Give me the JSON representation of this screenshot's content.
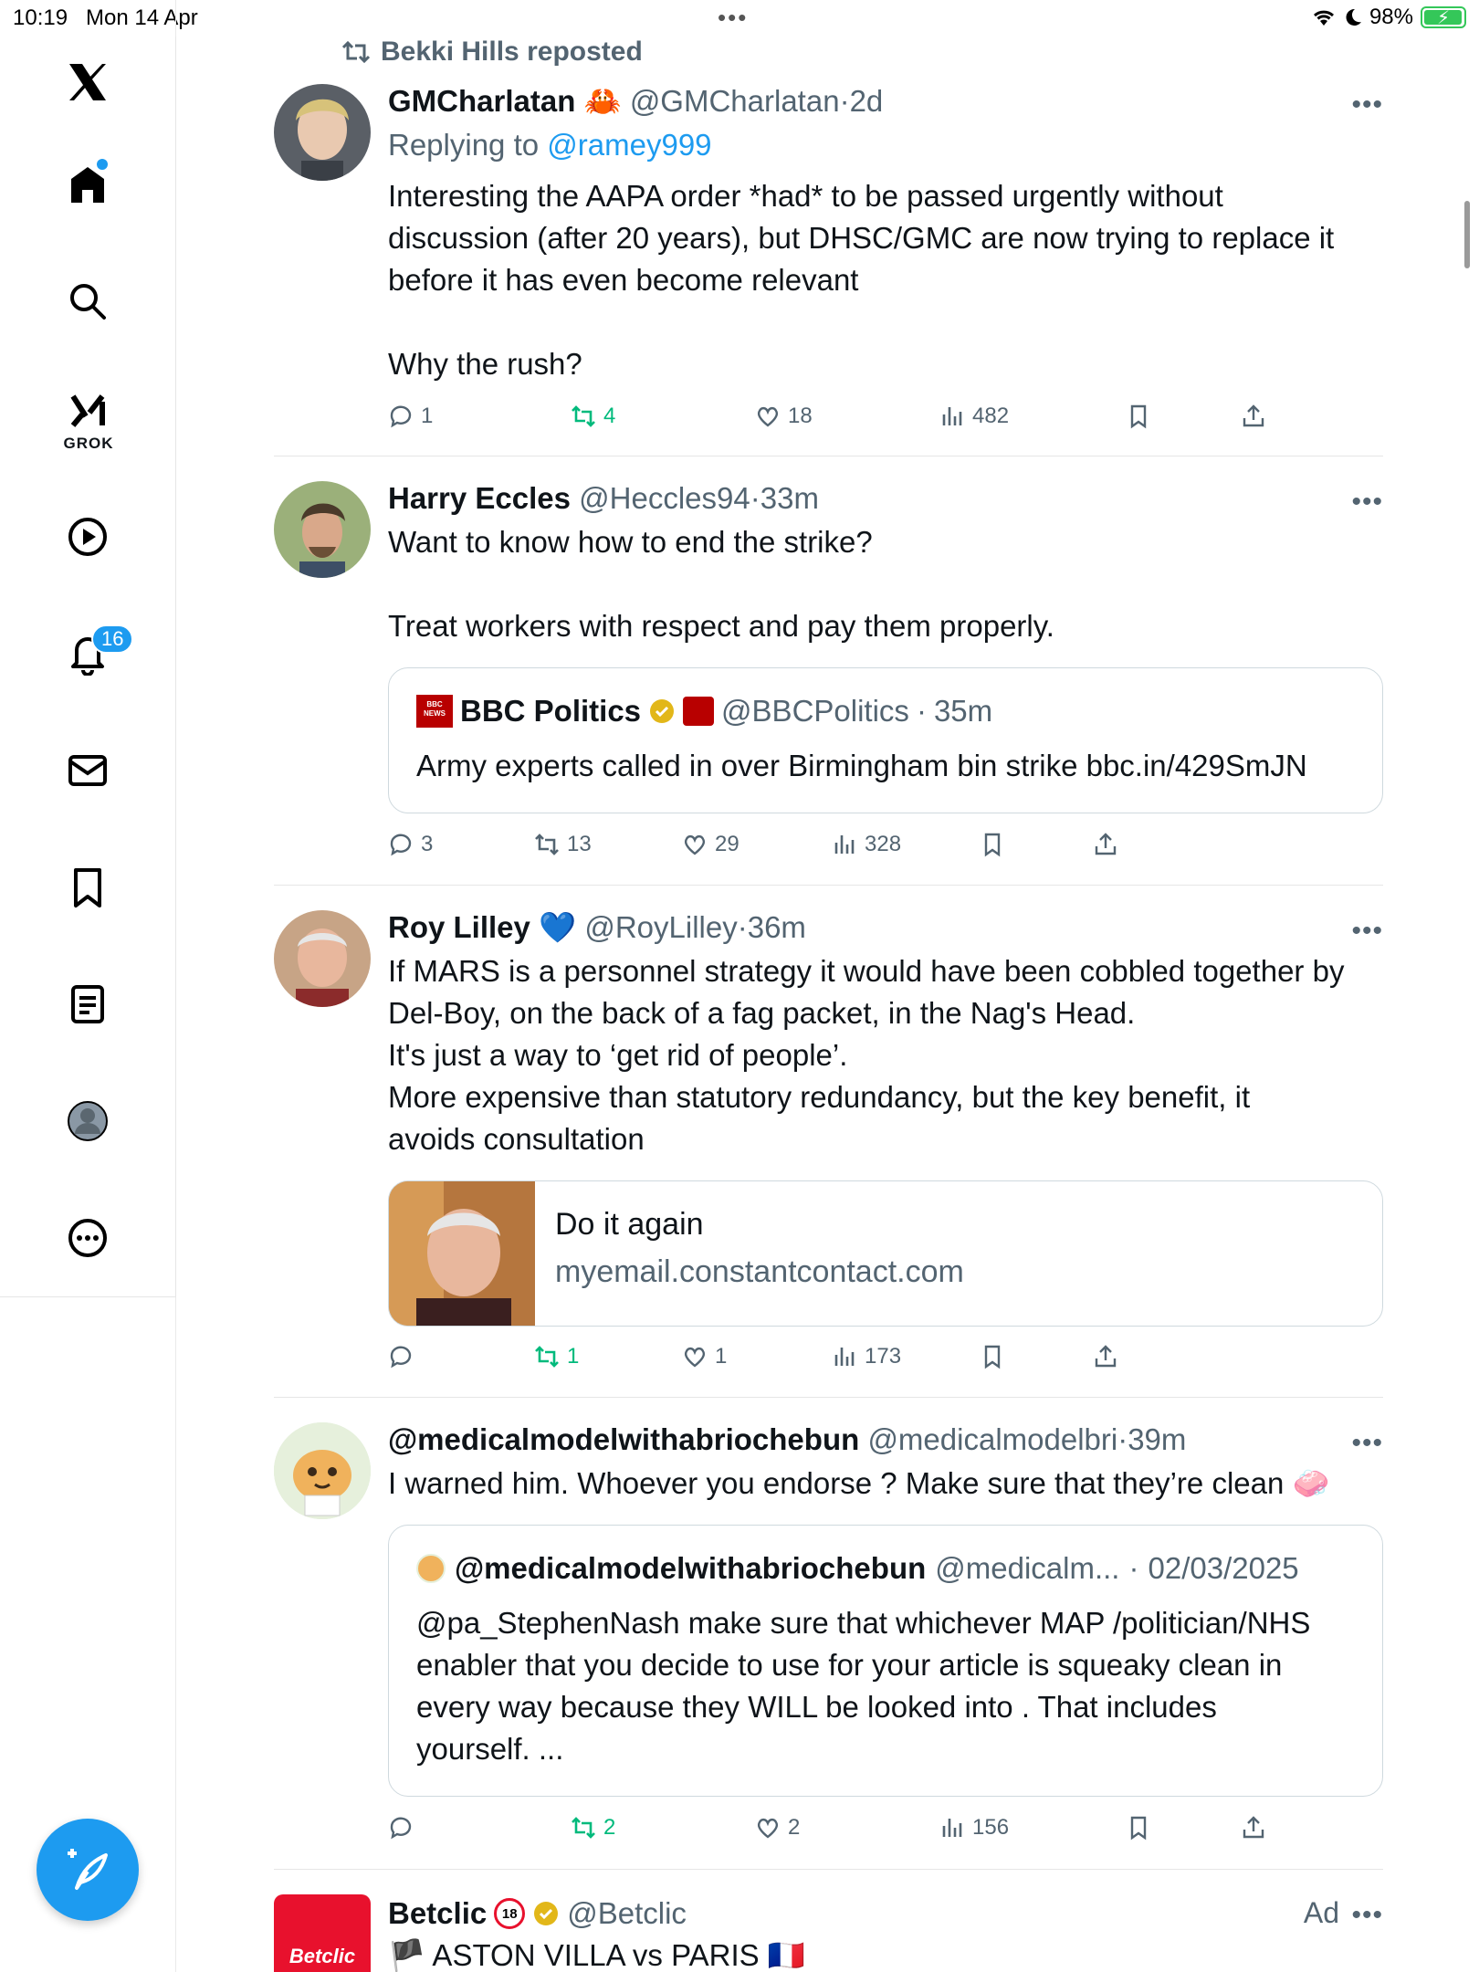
{
  "status": {
    "time": "10:19",
    "date": "Mon 14 Apr",
    "battery": "98%"
  },
  "sidebar": {
    "grok_label": "GROK",
    "notifications_badge": "16"
  },
  "repost": {
    "text": "Bekki Hills reposted"
  },
  "tweets": [
    {
      "name": "GMCharlatan",
      "emoji": "🦀",
      "handle": "@GMCharlatan",
      "sep": "·",
      "time": "2d",
      "replying_label": "Replying to",
      "replying_to": "@ramey999",
      "text": "Interesting the AAPA order *had* to be passed urgently without\ndiscussion (after 20 years), but DHSC/GMC are now trying to replace it\nbefore it has even become relevant\n\nWhy the rush?",
      "replies": "1",
      "reposts": "4",
      "likes": "18",
      "views": "482"
    },
    {
      "name": "Harry Eccles",
      "handle": "@Heccles94",
      "sep": "·",
      "time": "33m",
      "text": "Want to know how to end the strike?\n\nTreat workers with respect and pay them properly.",
      "quote": {
        "name": "BBC Politics",
        "handle": "@BBCPolitics",
        "sep": "·",
        "time": "35m",
        "text": "Army experts called in over Birmingham bin strike bbc.in/429SmJN",
        "logo_text": "BBC NEWS POLITICS"
      },
      "replies": "3",
      "reposts": "13",
      "likes": "29",
      "views": "328"
    },
    {
      "name": "Roy Lilley",
      "emoji": "💙",
      "handle": "@RoyLilley",
      "sep": "·",
      "time": "36m",
      "text": "If MARS is a personnel strategy it would have been cobbled together by\nDel-Boy, on the back of a fag packet, in the Nag's Head.\nIt's just a way to ‘get rid of people’.\nMore expensive than statutory redundancy, but the key benefit, it\navoids consultation",
      "card": {
        "title": "Do it again",
        "domain": "myemail.constantcontact.com"
      },
      "replies": "",
      "reposts": "1",
      "likes": "1",
      "views": "173"
    },
    {
      "name": "@medicalmodelwithabriochebun",
      "handle": "@medicalmodelbri",
      "sep": "·",
      "time": "39m",
      "text": "I warned him. Whoever you endorse ? Make sure that they’re clean 🧼",
      "quote": {
        "name": "@medicalmodelwithabriochebun",
        "handle": "@medicalm...",
        "sep": "·",
        "time": "02/03/2025",
        "text": "@pa_StephenNash make sure that whichever MAP /politician/NHS\nenabler that you decide to use for your article is squeaky clean in\nevery way because they WILL be looked into . That includes\nyourself. ..."
      },
      "replies": "",
      "reposts": "2",
      "likes": "2",
      "views": "156"
    },
    {
      "name": "Betclic",
      "handle": "@Betclic",
      "ad": "Ad",
      "logo_text": "Betclic",
      "age_badge": "18",
      "text": "🏴 ASTON VILLA vs PARIS 🇫🇷"
    }
  ],
  "colors": {
    "accent": "#1d9bf0",
    "repost_green": "#00ba7c",
    "muted": "#536471",
    "betclic_red": "#e8112d",
    "bbc_red": "#b80000"
  },
  "icons": [
    "x-logo-icon",
    "home-icon",
    "search-icon",
    "grok-icon",
    "video-icon",
    "notifications-icon",
    "messages-icon",
    "bookmarks-icon",
    "lists-icon",
    "profile-icon",
    "more-icon",
    "compose-icon",
    "reply-icon",
    "repost-icon",
    "like-icon",
    "views-icon",
    "bookmark-icon",
    "share-icon"
  ]
}
